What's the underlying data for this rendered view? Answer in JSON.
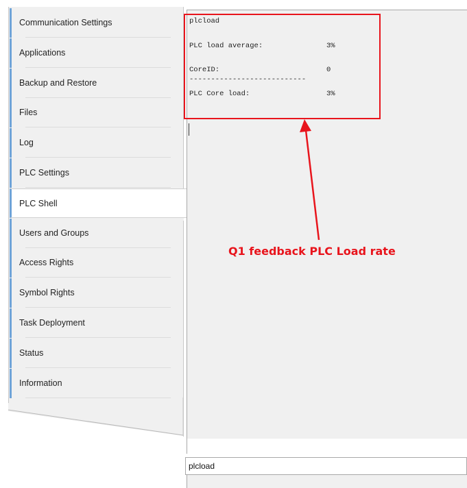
{
  "sidebar": {
    "items": [
      {
        "label": "Communication Settings"
      },
      {
        "label": "Applications"
      },
      {
        "label": "Backup and Restore"
      },
      {
        "label": "Files"
      },
      {
        "label": "Log"
      },
      {
        "label": "PLC Settings"
      },
      {
        "label": "PLC Shell",
        "active": true
      },
      {
        "label": "Users and Groups"
      },
      {
        "label": "Access Rights"
      },
      {
        "label": "Symbol Rights"
      },
      {
        "label": "Task Deployment"
      },
      {
        "label": "Status"
      },
      {
        "label": "Information"
      }
    ]
  },
  "shell": {
    "command_echo": "plcload",
    "load_average_label": "PLC load average:",
    "load_average_value": "3%",
    "core_id_label": "CoreID:",
    "core_id_value": "0",
    "separator": "---------------------------",
    "core_load_label": "PLC Core load:",
    "core_load_value": "3%",
    "input_value": "plcload"
  },
  "annotation": {
    "text": "Q1 feedback PLC Load rate",
    "color": "#e8141c"
  },
  "colors": {
    "tab_accent": "#6ea3d8",
    "sidebar_bg": "#f0f0f0",
    "output_bg": "#f0f0f0"
  }
}
